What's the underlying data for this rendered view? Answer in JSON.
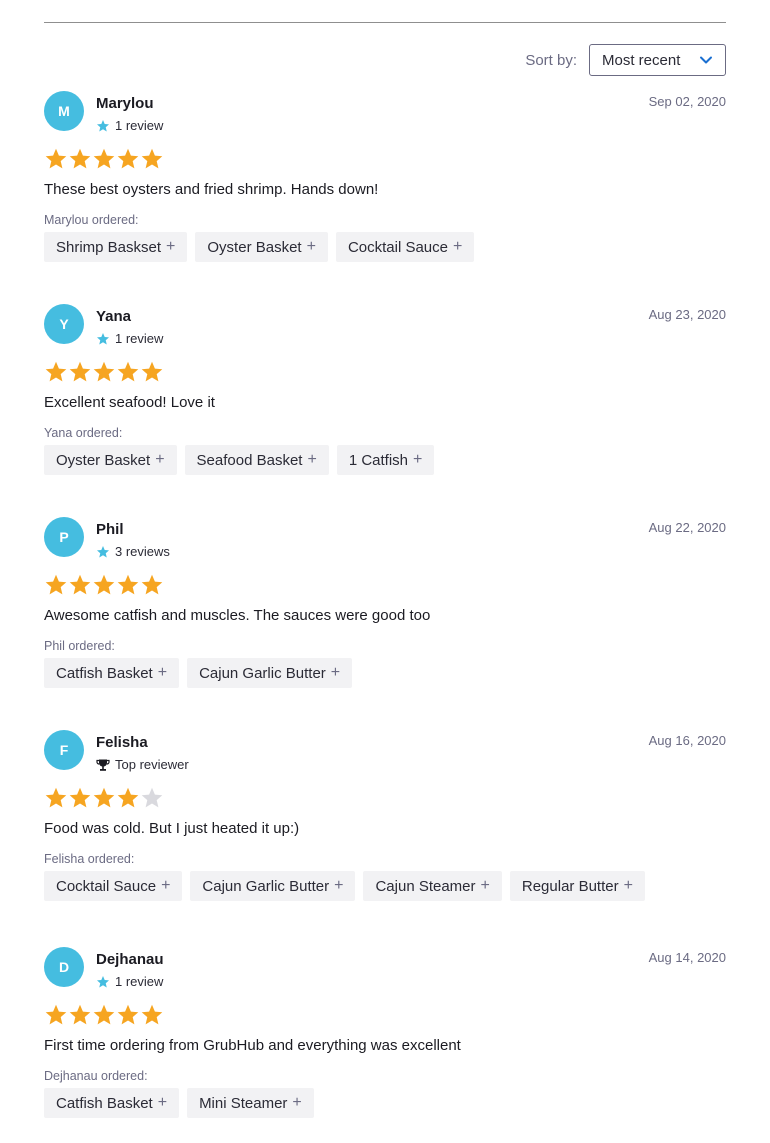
{
  "colors": {
    "avatar": "#45bde0",
    "star_filled": "#f6a521",
    "star_empty": "#d9d9de",
    "meta_star": "#45bde0"
  },
  "sort": {
    "label": "Sort by:",
    "value": "Most recent"
  },
  "reviews": [
    {
      "initial": "M",
      "name": "Marylou",
      "meta_icon": "star-icon",
      "meta": "1 review",
      "date": "Sep 02, 2020",
      "rating": 5,
      "text": "These best oysters and fried shrimp. Hands down!",
      "ordered_label": "Marylou ordered:",
      "items": [
        "Shrimp Baskset",
        "Oyster Basket",
        "Cocktail Sauce"
      ]
    },
    {
      "initial": "Y",
      "name": "Yana",
      "meta_icon": "star-icon",
      "meta": "1 review",
      "date": "Aug 23, 2020",
      "rating": 5,
      "text": "Excellent seafood! Love it",
      "ordered_label": "Yana ordered:",
      "items": [
        "Oyster Basket",
        "Seafood Basket",
        "1 Catfish"
      ]
    },
    {
      "initial": "P",
      "name": "Phil",
      "meta_icon": "star-icon",
      "meta": "3 reviews",
      "date": "Aug 22, 2020",
      "rating": 5,
      "text": "Awesome catfish and muscles. The sauces were good too",
      "ordered_label": "Phil ordered:",
      "items": [
        "Catfish Basket",
        "Cajun Garlic Butter"
      ]
    },
    {
      "initial": "F",
      "name": "Felisha",
      "meta_icon": "trophy-icon",
      "meta": "Top reviewer",
      "date": "Aug 16, 2020",
      "rating": 4,
      "text": "Food was cold. But I just heated it up:)",
      "ordered_label": "Felisha ordered:",
      "items": [
        "Cocktail Sauce",
        "Cajun Garlic Butter",
        "Cajun Steamer",
        "Regular Butter"
      ]
    },
    {
      "initial": "D",
      "name": "Dejhanau",
      "meta_icon": "star-icon",
      "meta": "1 review",
      "date": "Aug 14, 2020",
      "rating": 5,
      "text": "First time ordering from GrubHub and everything was excellent",
      "ordered_label": "Dejhanau ordered:",
      "items": [
        "Catfish Basket",
        "Mini Steamer"
      ]
    }
  ]
}
